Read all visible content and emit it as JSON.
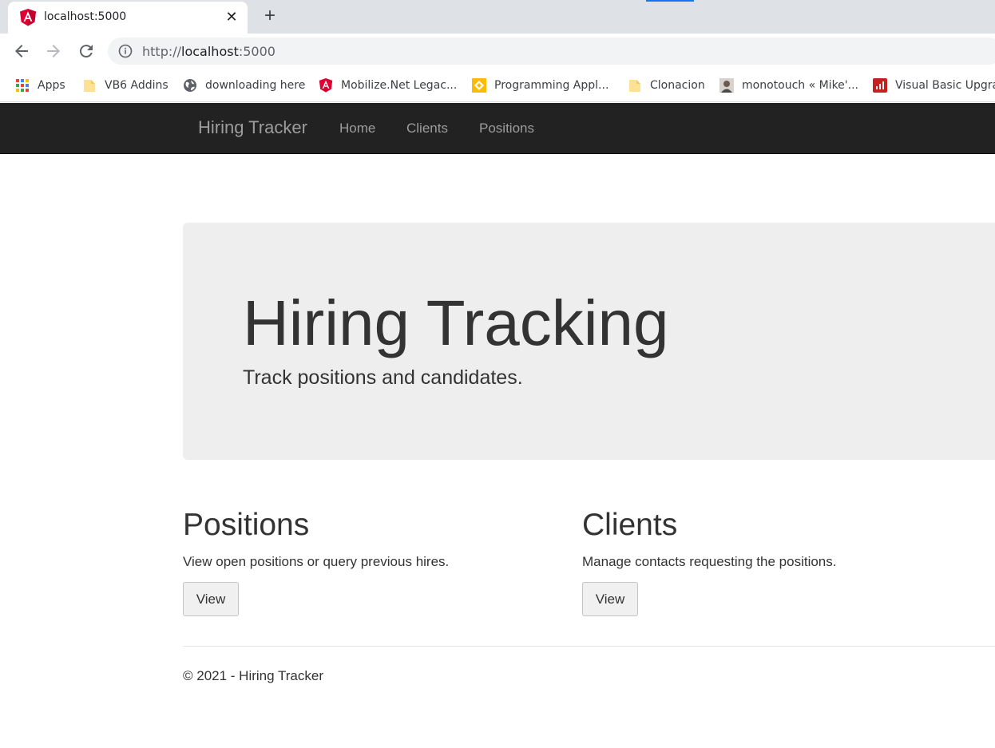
{
  "browser": {
    "tab": {
      "title": "localhost:5000",
      "close_glyph": "✕",
      "favicon": "angular-icon"
    },
    "new_tab_glyph": "+",
    "address": {
      "scheme": "http://",
      "host": "localhost",
      "port": ":5000"
    },
    "bookmarks": [
      {
        "label": "Apps",
        "icon": "apps-grid-icon"
      },
      {
        "label": "VB6 Addins",
        "icon": "folder-icon"
      },
      {
        "label": "downloading here",
        "icon": "globe-icon"
      },
      {
        "label": "Mobilize.Net Legac...",
        "icon": "angular-icon"
      },
      {
        "label": "Programming Appl...",
        "icon": "diamond-icon"
      },
      {
        "label": "Clonacion",
        "icon": "folder-icon"
      },
      {
        "label": "monotouch « Mike'...",
        "icon": "avatar-icon"
      },
      {
        "label": "Visual Basic Upgrad",
        "icon": "chart-icon"
      }
    ]
  },
  "navbar": {
    "brand": "Hiring Tracker",
    "links": [
      "Home",
      "Clients",
      "Positions"
    ]
  },
  "jumbotron": {
    "title": "Hiring Tracking",
    "subtitle": "Track positions and candidates."
  },
  "sections": [
    {
      "heading": "Positions",
      "text": "View open positions or query previous hires.",
      "button": "View"
    },
    {
      "heading": "Clients",
      "text": "Manage contacts requesting the positions.",
      "button": "View"
    }
  ],
  "footer": "© 2021 - Hiring Tracker",
  "colors": {
    "navbar_bg": "#222222",
    "nav_text": "#9d9d9d",
    "jumbotron_bg": "#eeeeee",
    "text": "#333333",
    "angular_red": "#dd0031"
  }
}
